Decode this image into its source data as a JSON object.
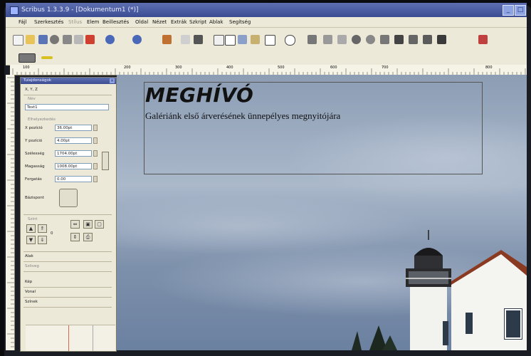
{
  "window": {
    "title": "Scribus 1.3.3.9 - [Dokumentum1 (*)]",
    "min_btn": "_",
    "max_btn": "□",
    "close_btn": "×"
  },
  "menu": [
    {
      "label": "Fájl"
    },
    {
      "label": "Szerkesztés"
    },
    {
      "label": "Stílus"
    },
    {
      "label": "Elem"
    },
    {
      "label": "Beillesztés"
    },
    {
      "label": "Oldal"
    },
    {
      "label": "Nézet"
    },
    {
      "label": "Extrák"
    },
    {
      "label": "Szkript"
    },
    {
      "label": "Ablak"
    },
    {
      "label": "Segítség"
    }
  ],
  "toolbar_icons": [
    "new-icon",
    "open-icon",
    "save-icon",
    "close-doc-icon",
    "print-icon",
    "preflight-icon",
    "pdf-icon",
    "undo-icon",
    "redo-icon",
    "cut-icon",
    "copy-icon",
    "paste-icon",
    "select-icon",
    "text-frame-icon",
    "image-frame-icon",
    "table-icon",
    "shape-icon",
    "polygon-icon",
    "line-icon",
    "bezier-icon",
    "freehand-icon",
    "rotate-icon",
    "zoom-icon",
    "edit-text-icon",
    "link-icon",
    "unlink-icon",
    "measure-icon",
    "copy-props-icon",
    "eyedropper-icon"
  ],
  "ruler_labels": [
    "100",
    "200",
    "300",
    "400",
    "500",
    "600",
    "700",
    "800"
  ],
  "properties_panel": {
    "title": "Tulajdonságok",
    "tab_xyz": "X, Y, Z",
    "section_name": "Név",
    "name_value": "Text1",
    "section_geometry": "Elhelyezkedés",
    "fields": [
      {
        "label": "X pozíció",
        "value": "36.00pt"
      },
      {
        "label": "Y pozíció",
        "value": "4.00pt"
      },
      {
        "label": "Szélesség",
        "value": "1704.00pt"
      },
      {
        "label": "Magasság",
        "value": "1008.00pt"
      },
      {
        "label": "Forgatás",
        "value": "0.00"
      }
    ],
    "basepoint_label": "Bázispont",
    "level_label": "Szint",
    "level_value": "0",
    "section_shape": "Alak",
    "section_text": "Szöveg",
    "section_image": "Kép",
    "section_line": "Vonal",
    "section_colors": "Színek"
  },
  "document": {
    "headline": "MEGHÍVÓ",
    "subline": "Galériánk első árverésének ünnepélyes megnyitójára"
  },
  "colors": {
    "titlebar": "#3c4c93",
    "chrome": "#ece9d8",
    "frame_border": "#555555"
  }
}
